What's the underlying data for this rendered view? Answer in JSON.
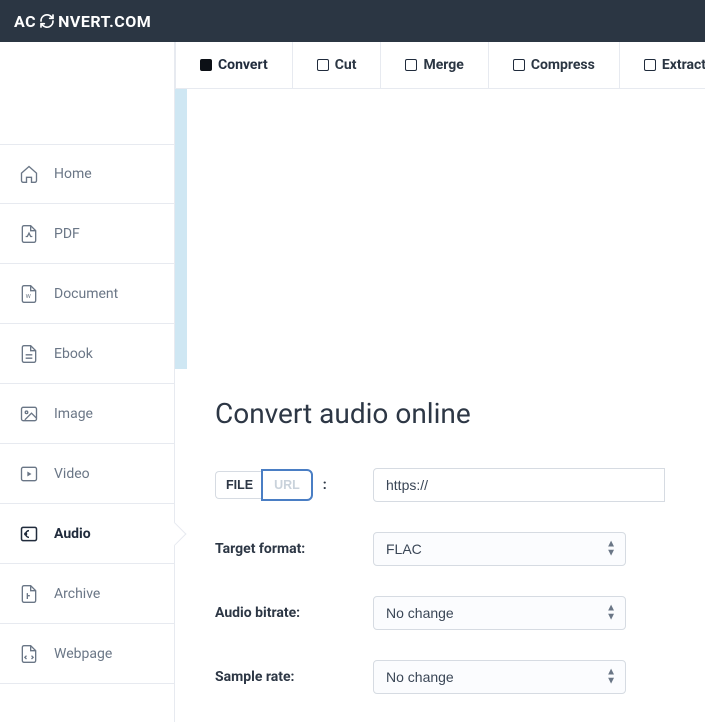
{
  "brand": {
    "prefix": "AC",
    "suffix": "NVERT.COM"
  },
  "sidebar": {
    "items": [
      {
        "label": "Home"
      },
      {
        "label": "PDF"
      },
      {
        "label": "Document"
      },
      {
        "label": "Ebook"
      },
      {
        "label": "Image"
      },
      {
        "label": "Video"
      },
      {
        "label": "Audio"
      },
      {
        "label": "Archive"
      },
      {
        "label": "Webpage"
      }
    ]
  },
  "tabs": [
    {
      "label": "Convert",
      "active": true
    },
    {
      "label": "Cut",
      "active": false
    },
    {
      "label": "Merge",
      "active": false
    },
    {
      "label": "Compress",
      "active": false
    },
    {
      "label": "Extract",
      "active": false
    }
  ],
  "page": {
    "heading": "Convert audio online",
    "input_toggle": {
      "file": "FILE",
      "url": "URL"
    },
    "url_value": "https://",
    "labels": {
      "target_format": "Target format:",
      "audio_bitrate": "Audio bitrate:",
      "sample_rate": "Sample rate:"
    },
    "selects": {
      "target_format": "FLAC",
      "audio_bitrate": "No change",
      "sample_rate": "No change"
    }
  }
}
